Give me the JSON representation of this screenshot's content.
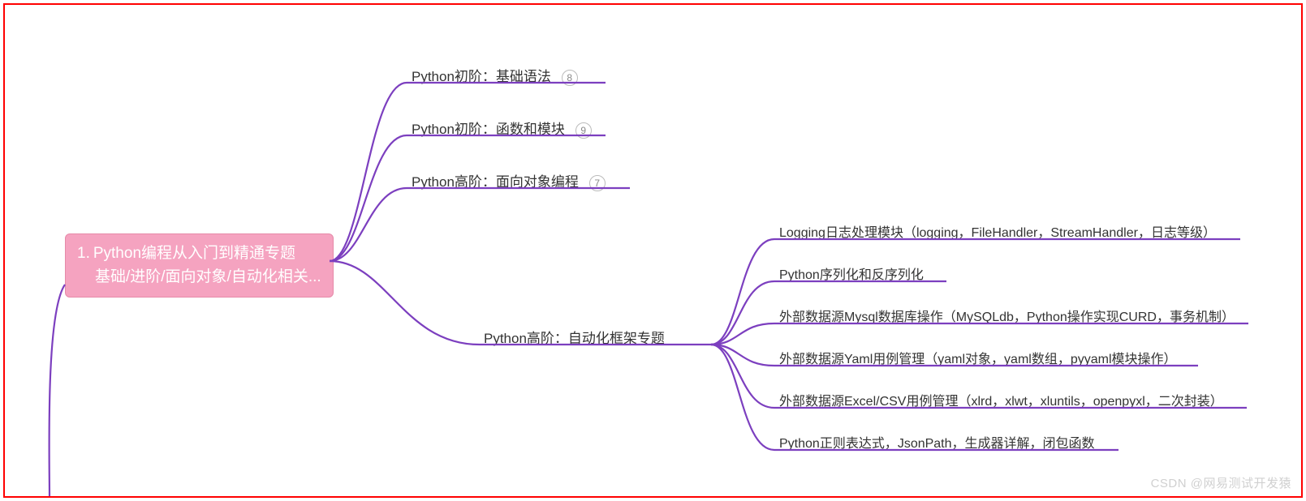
{
  "root": {
    "number": "1.",
    "line1": "Python编程从入门到精通专题",
    "line2": "基础/进阶/面向对象/自动化相关..."
  },
  "branches": {
    "b1": {
      "label": "Python初阶：基础语法",
      "badge": "8"
    },
    "b2": {
      "label": "Python初阶：函数和模块",
      "badge": "9"
    },
    "b3": {
      "label": "Python高阶：面向对象编程",
      "badge": "7"
    },
    "b4": {
      "label": "Python高阶：自动化框架专题"
    }
  },
  "leaves": {
    "l1": "Logging日志处理模块（logging，FileHandler，StreamHandler，日志等级）",
    "l2": "Python序列化和反序列化",
    "l3": "外部数据源Mysql数据库操作（MySQLdb，Python操作实现CURD，事务机制）",
    "l4": "外部数据源Yaml用例管理（yaml对象，yaml数组，pyyaml模块操作）",
    "l5": "外部数据源Excel/CSV用例管理（xlrd，xlwt，xluntils，openpyxl，二次封装）",
    "l6": "Python正则表达式，JsonPath，生成器详解，闭包函数"
  },
  "colors": {
    "stroke": "#7c3fbf",
    "root_bg": "#f5a3c0"
  },
  "watermark": "CSDN @网易测试开发猿"
}
